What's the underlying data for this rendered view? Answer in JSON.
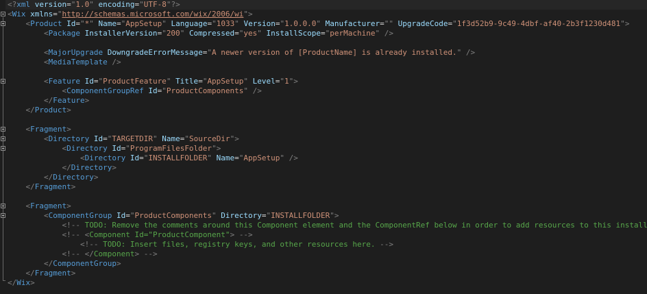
{
  "colors": {
    "background": "#1e1e1e",
    "delimiter": "#808080",
    "element": "#569cd6",
    "attribute": "#9cdcfe",
    "value": "#ce9178",
    "comment": "#57a64a"
  },
  "icons": {
    "fold": "collapse-minus-icon"
  },
  "lines": [
    "<?xml version=\"1.0\" encoding=\"UTF-8\"?>",
    "<Wix xmlns=\"http://schemas.microsoft.com/wix/2006/wi\">",
    "    <Product Id=\"*\" Name=\"AppSetup\" Language=\"1033\" Version=\"1.0.0.0\" Manufacturer=\"\" UpgradeCode=\"1f3d52b9-9c49-4dbf-af40-2b3f1230d481\">",
    "        <Package InstallerVersion=\"200\" Compressed=\"yes\" InstallScope=\"perMachine\" />",
    "",
    "        <MajorUpgrade DowngradeErrorMessage=\"A newer version of [ProductName] is already installed.\" />",
    "        <MediaTemplate />",
    "",
    "        <Feature Id=\"ProductFeature\" Title=\"AppSetup\" Level=\"1\">",
    "            <ComponentGroupRef Id=\"ProductComponents\" />",
    "        </Feature>",
    "    </Product>",
    "",
    "    <Fragment>",
    "        <Directory Id=\"TARGETDIR\" Name=\"SourceDir\">",
    "            <Directory Id=\"ProgramFilesFolder\">",
    "                <Directory Id=\"INSTALLFOLDER\" Name=\"AppSetup\" />",
    "            </Directory>",
    "        </Directory>",
    "    </Fragment>",
    "",
    "    <Fragment>",
    "        <ComponentGroup Id=\"ProductComponents\" Directory=\"INSTALLFOLDER\">",
    "            <!-- TODO: Remove the comments around this Component element and the ComponentRef below in order to add resources to this installer. -->",
    "            <!-- <Component Id=\"ProductComponent\"> -->",
    "                <!-- TODO: Insert files, registry keys, and other resources here. -->",
    "            <!-- </Component> -->",
    "        </ComponentGroup>",
    "    </Fragment>",
    "</Wix>"
  ]
}
